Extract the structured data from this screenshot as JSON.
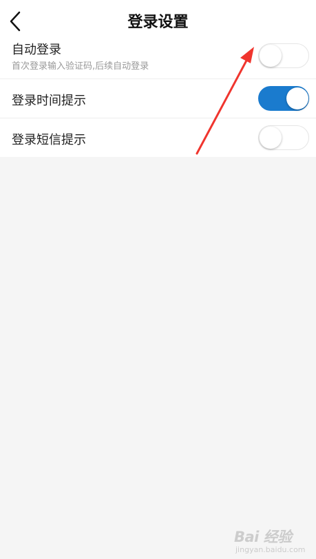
{
  "header": {
    "title": "登录设置",
    "back_icon": "chevron-left-icon"
  },
  "settings": [
    {
      "label": "自动登录",
      "sublabel": "首次登录输入验证码,后续自动登录",
      "enabled": false
    },
    {
      "label": "登录时间提示",
      "enabled": true
    },
    {
      "label": "登录短信提示",
      "enabled": false
    }
  ],
  "colors": {
    "toggle_on": "#1a7bce",
    "toggle_off": "#ffffff",
    "arrow": "#f0352e",
    "background": "#f5f5f5"
  },
  "watermark": {
    "logo": "Bai 经验",
    "url": "jingyan.baidu.com"
  }
}
